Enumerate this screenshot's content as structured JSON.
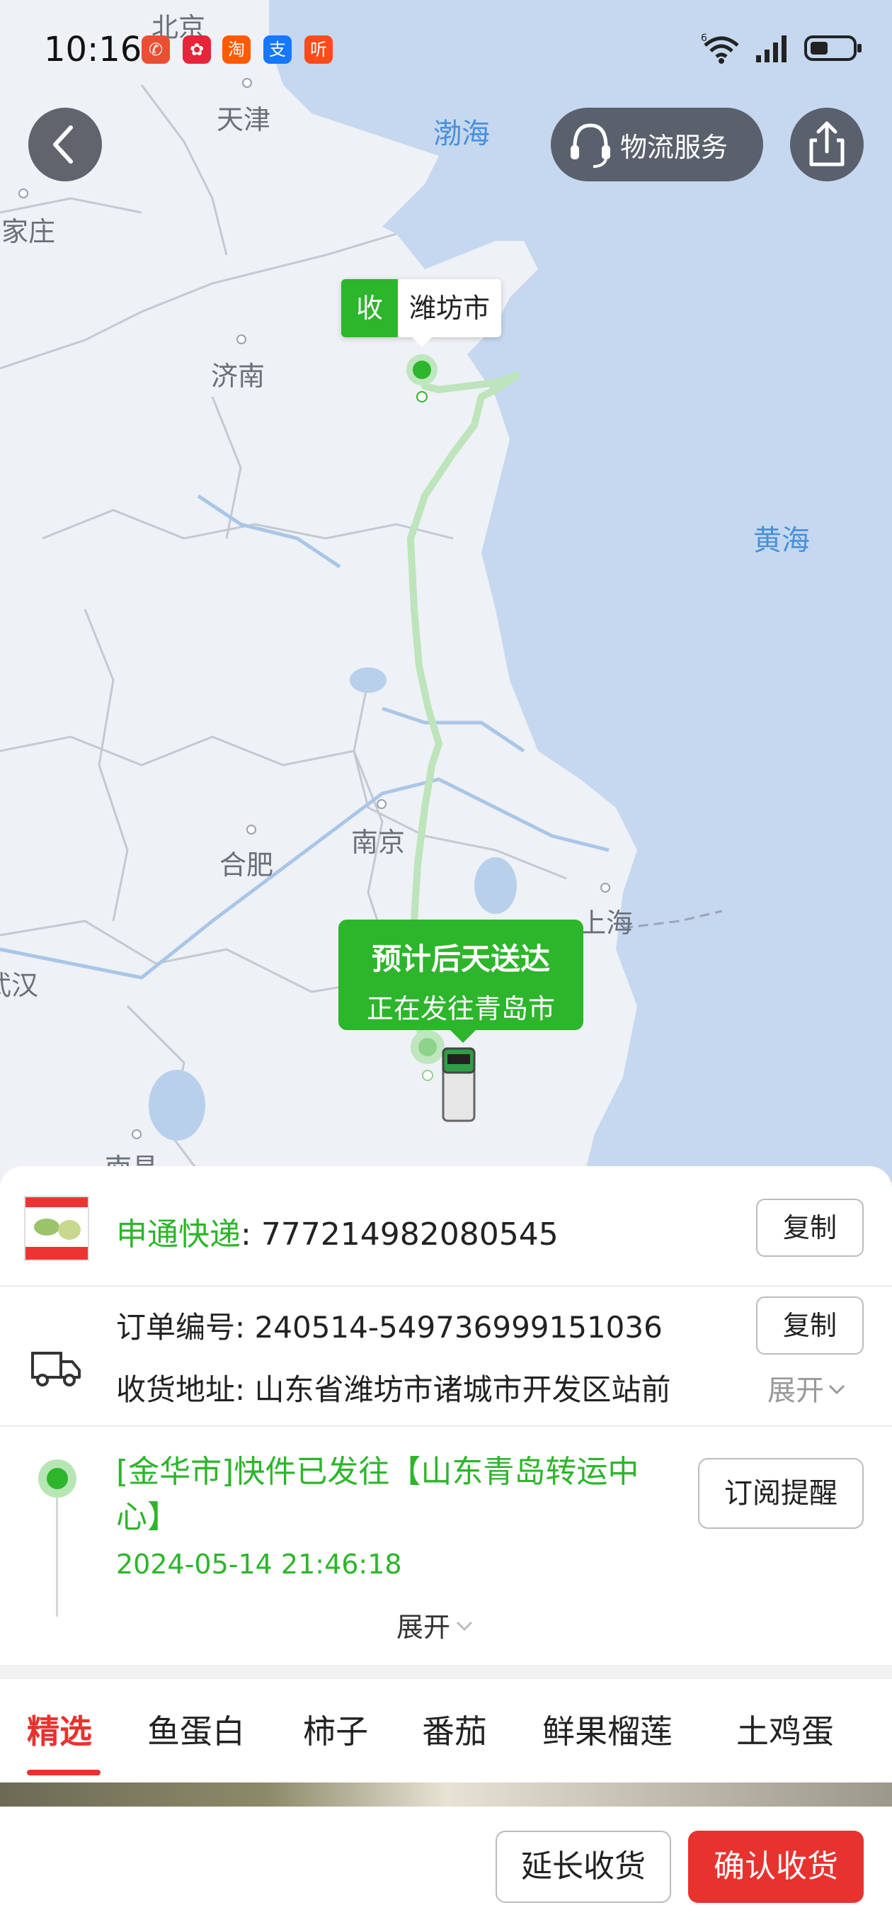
{
  "status_bar": {
    "time": "10:16",
    "apps": [
      {
        "icon": "app-icon-1",
        "glyph": "✆",
        "color": "#ea4f33"
      },
      {
        "icon": "app-icon-2",
        "glyph": "✿",
        "color": "#e6243a"
      },
      {
        "icon": "taobao-icon",
        "glyph": "淘",
        "color": "#ff5a00"
      },
      {
        "icon": "alipay-icon",
        "glyph": "支",
        "color": "#1677ff"
      },
      {
        "icon": "listen-icon",
        "glyph": "听",
        "color": "#ff4a1a"
      }
    ],
    "network": "6"
  },
  "header": {
    "service_label": "物流服务"
  },
  "map": {
    "cities": [
      {
        "name": "北京",
        "key": "beijing"
      },
      {
        "name": "天津",
        "key": "tianjin"
      },
      {
        "name": "石家庄",
        "key": "shijiazhuang"
      },
      {
        "name": "济南",
        "key": "jinan"
      },
      {
        "name": "南京",
        "key": "nanjing"
      },
      {
        "name": "合肥",
        "key": "hefei"
      },
      {
        "name": "上海",
        "key": "shanghai"
      },
      {
        "name": "武汉",
        "key": "wuhan"
      },
      {
        "name": "南昌",
        "key": "nanchang"
      }
    ],
    "seas": [
      {
        "name": "渤海",
        "key": "bohai"
      },
      {
        "name": "黄海",
        "key": "huanghai"
      }
    ],
    "destination": {
      "tag": "收",
      "city": "潍坊市"
    },
    "eta": {
      "line1": "预计后天送达",
      "line2": "正在发往青岛市"
    }
  },
  "card": {
    "courier_name": "申通快递",
    "tracking_no": "777214982080545",
    "copy_label": "复制",
    "order_label": "订单编号",
    "order_no": "240514-549736999151036",
    "address_label": "收货地址",
    "address": "山东省潍坊市诸城市开发区站前",
    "expand_label": "展开",
    "track_event": "[金华市]快件已发往【山东青岛转运中心】",
    "track_time": "2024-05-14 21:46:18",
    "subscribe_label": "订阅提醒",
    "expand_more": "展开"
  },
  "tabs": [
    "精选",
    "鱼蛋白",
    "柿子",
    "番茄",
    "鲜果榴莲",
    "土鸡蛋"
  ],
  "bottom": {
    "extend_label": "延长收货",
    "confirm_label": "确认收货"
  },
  "colors": {
    "accent_green": "#2db52b",
    "accent_red": "#e8322e",
    "sea": "#c5d8ef"
  }
}
